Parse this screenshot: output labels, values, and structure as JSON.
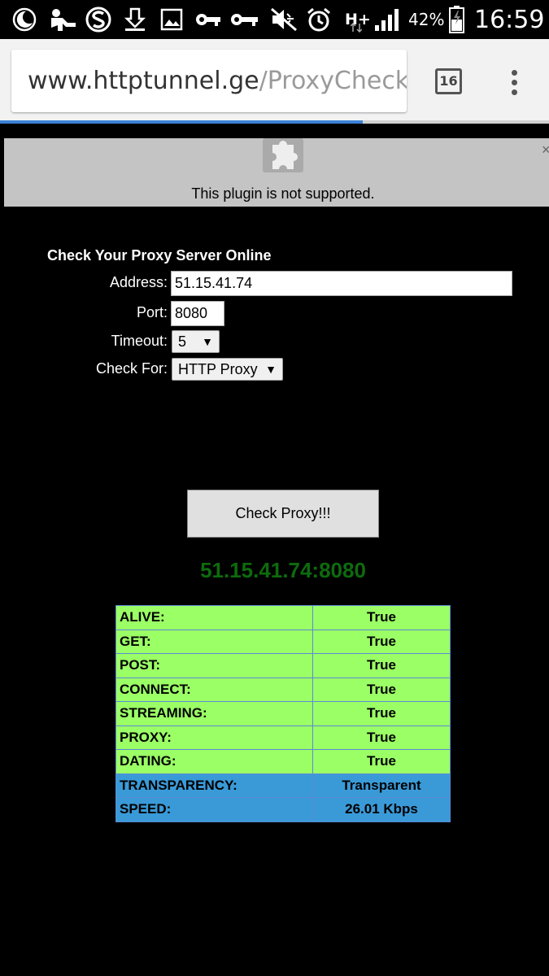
{
  "status_bar": {
    "signal_label": "H+",
    "battery_percent": "42%",
    "time": "16:59",
    "icons": [
      "moon-icon",
      "child-icon",
      "s-app-icon",
      "download-icon",
      "image-icon",
      "key-icon",
      "key-icon",
      "mute-icon",
      "alarm-icon",
      "signal-icon",
      "battery-icon"
    ]
  },
  "browser": {
    "url_host": "www.httptunnel.ge",
    "url_path": "/ProxyChecker.a",
    "tab_count": "16",
    "load_progress": 0.66
  },
  "plugin": {
    "message": "This plugin is not supported.",
    "close": "×"
  },
  "form": {
    "title": "Check Your Proxy Server Online",
    "address_label": "Address:",
    "address_value": "51.15.41.74",
    "port_label": "Port:",
    "port_value": "8080",
    "timeout_label": "Timeout:",
    "timeout_value": "5",
    "check_for_label": "Check For:",
    "check_for_value": "HTTP Proxy",
    "submit_label": "Check Proxy!!!"
  },
  "result": {
    "title": "51.15.41.74:8080",
    "rows": [
      {
        "key": "ALIVE:",
        "value": "True"
      },
      {
        "key": "GET:",
        "value": "True"
      },
      {
        "key": "POST:",
        "value": "True"
      },
      {
        "key": "CONNECT:",
        "value": "True"
      },
      {
        "key": "STREAMING:",
        "value": "True"
      },
      {
        "key": "PROXY:",
        "value": "True"
      },
      {
        "key": "DATING:",
        "value": "True"
      },
      {
        "key": "TRANSPARENCY:",
        "value": "Transparent"
      },
      {
        "key": "SPEED:",
        "value": "26.01 Kbps"
      }
    ]
  },
  "colors": {
    "row_green": "#9bff66",
    "row_blue": "#3a9ad8",
    "result_title": "#0d6b0d",
    "progress": "#3b82d6"
  }
}
